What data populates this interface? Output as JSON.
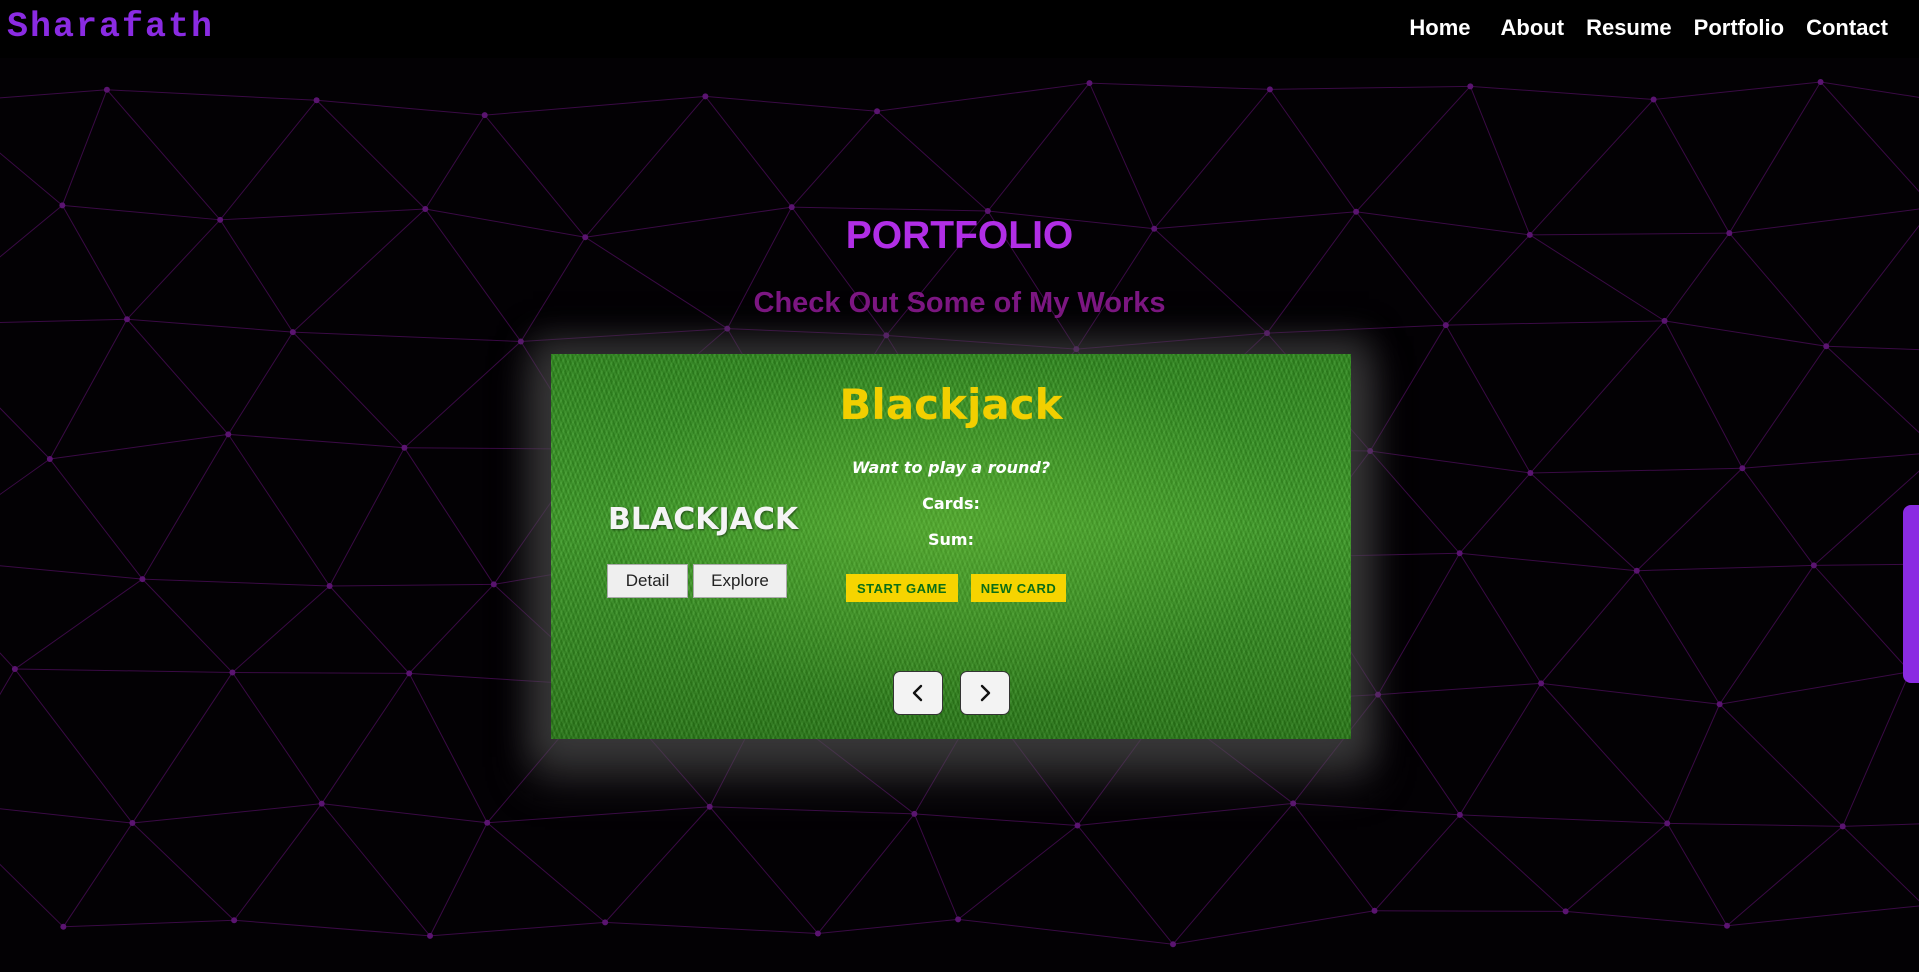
{
  "nav": {
    "logo": "Sharafath",
    "links": [
      "Home",
      "About",
      "Resume",
      "Portfolio",
      "Contact"
    ]
  },
  "portfolio": {
    "title": "PORTFOLIO",
    "subtitle": "Check Out Some of My Works"
  },
  "slide": {
    "project_name": "BLACKJACK",
    "detail_label": "Detail",
    "explore_label": "Explore",
    "game": {
      "title": "Blackjack",
      "prompt": "Want to play a round?",
      "cards_label": "Cards:",
      "sum_label": "Sum:",
      "start_label": "START GAME",
      "new_card_label": "NEW CARD"
    }
  },
  "icons": {
    "prev": "chevron-left-icon",
    "next": "chevron-right-icon"
  },
  "colors": {
    "brand": "#8a2be2",
    "title": "#b12ee6",
    "subtitle": "#7d1783",
    "game_title": "#f2cf00",
    "game_button": "#f6d400"
  }
}
